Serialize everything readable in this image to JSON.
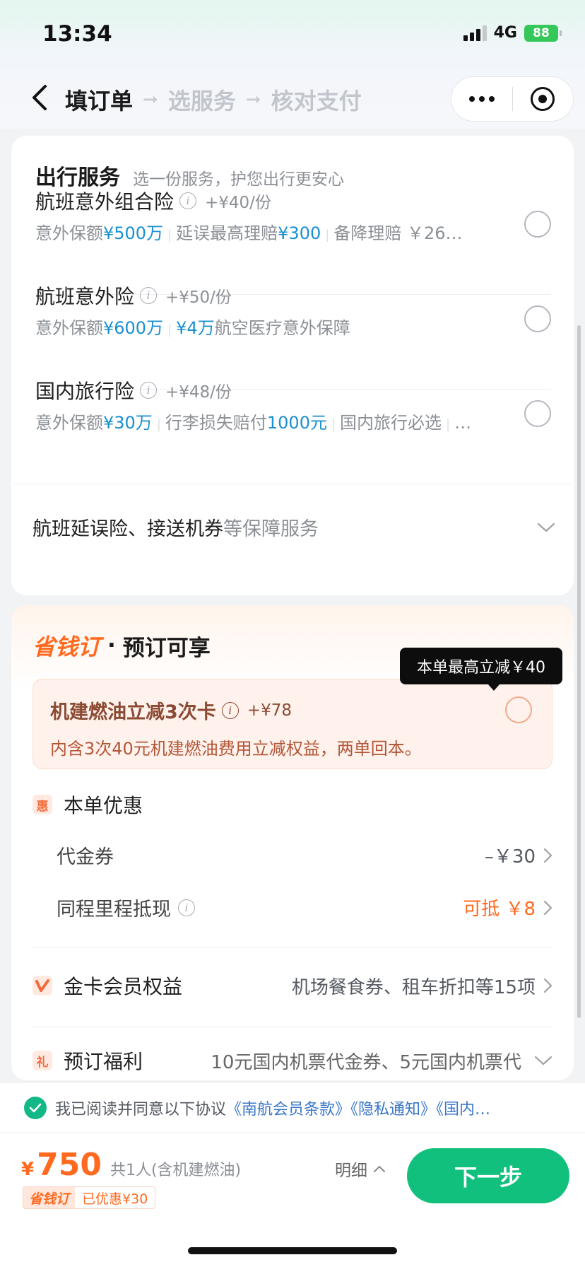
{
  "status": {
    "time": "13:34",
    "network": "4G",
    "battery": "88"
  },
  "nav": {
    "steps": [
      "填订单",
      "选服务",
      "核对支付"
    ],
    "arrow": "➞"
  },
  "service": {
    "title": "出行服务",
    "subtitle": "选一份服务，护您出行更安心",
    "items": [
      {
        "name": "航班意外组合险",
        "price": "+¥40/份",
        "desc": [
          {
            "t": "意外保额"
          },
          {
            "t": "¥500万",
            "h": true
          },
          {
            "sep": true
          },
          {
            "t": "延误最高理赔"
          },
          {
            "t": "¥300",
            "h": true
          },
          {
            "sep": true
          },
          {
            "t": "备降理赔 ￥26…"
          }
        ]
      },
      {
        "name": "航班意外险",
        "price": "+¥50/份",
        "desc": [
          {
            "t": "意外保额"
          },
          {
            "t": "¥600万",
            "h": true
          },
          {
            "sep": true
          },
          {
            "t": "¥4万",
            "h": true
          },
          {
            "t": "航空医疗意外保障"
          }
        ]
      },
      {
        "name": "国内旅行险",
        "price": "+¥48/份",
        "desc": [
          {
            "t": "意外保额"
          },
          {
            "t": "¥30万",
            "h": true
          },
          {
            "sep": true
          },
          {
            "t": "行李损失赔付"
          },
          {
            "t": "1000元",
            "h": true
          },
          {
            "sep": true
          },
          {
            "t": "国内旅行必选"
          },
          {
            "sep": true
          },
          {
            "t": "…"
          }
        ]
      }
    ],
    "more_main": "航班延误险、接送机券",
    "more_sub": "等保障服务"
  },
  "savings": {
    "brand": "省钱订",
    "dot": "·",
    "subtitle": "预订可享",
    "tooltip": "本单最高立减￥40",
    "card": {
      "name": "机建燃油立减3次卡",
      "price": "+¥78",
      "desc": "内含3次40元机建燃油费用立减权益，两单回本。"
    },
    "discount_title": "本单优惠",
    "discount_icon": "惠",
    "voucher_label": "代金券",
    "voucher_value": "–￥30",
    "mileage_label": "同程里程抵现",
    "mileage_value": "可抵 ￥8",
    "gold_title": "金卡会员权益",
    "gold_value": "机场餐食券、租车折扣等15项",
    "gift_icon": "礼",
    "gift_title": "预订福利",
    "gift_value": "10元国内机票代金券、5元国内机票代"
  },
  "agreement": {
    "text": "我已阅读并同意以下协议",
    "links": [
      "《南航会员条款》",
      "《隐私通知》",
      "《国内…"
    ]
  },
  "bottom": {
    "currency": "¥",
    "price": "750",
    "note": "共1人(含机建燃油)",
    "discount_brand": "省钱订",
    "discount_amount": "已优惠¥30",
    "detail": "明细",
    "next": "下一步"
  },
  "colors": {
    "accent": "#12c07d",
    "orange": "#ff6a1f",
    "link": "#1a8fd1"
  }
}
